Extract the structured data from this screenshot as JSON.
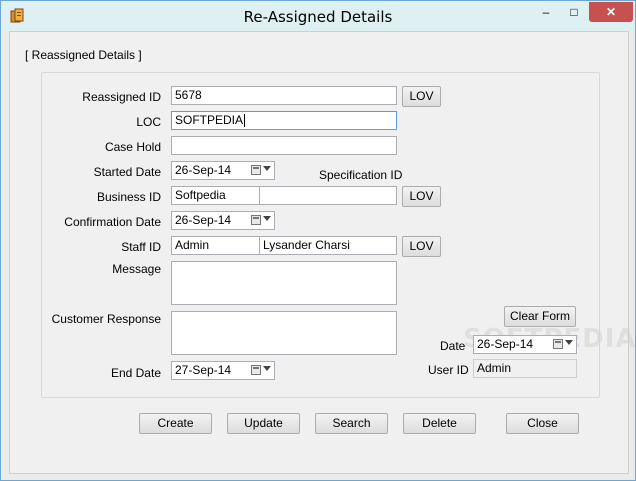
{
  "window": {
    "title": "Re-Assigned Details",
    "minimize": "–",
    "maximize": "□",
    "close": "✕"
  },
  "group": {
    "caption": "[ Reassigned Details ]"
  },
  "labels": {
    "reassigned_id": "Reassigned ID",
    "loc": "LOC",
    "case_hold": "Case Hold",
    "started_date": "Started Date",
    "specification_id": "Specification ID",
    "business_id": "Business ID",
    "confirmation_date": "Confirmation Date",
    "staff_id": "Staff ID",
    "message": "Message",
    "customer_response": "Customer Response",
    "end_date": "End Date",
    "date": "Date",
    "user_id": "User ID"
  },
  "fields": {
    "reassigned_id": "5678",
    "loc": "SOFTPEDIA",
    "case_hold": "",
    "started_date": "26-Sep-14",
    "business_id": "Softpedia",
    "business_name": "",
    "confirmation_date": "26-Sep-14",
    "staff_id": "Admin",
    "staff_name": "Lysander Charsi",
    "message": "",
    "customer_response": "",
    "end_date": "27-Sep-14",
    "date": "26-Sep-14",
    "user_id": "Admin"
  },
  "buttons": {
    "lov": "LOV",
    "clear_form": "Clear Form",
    "create": "Create",
    "update": "Update",
    "search": "Search",
    "delete": "Delete",
    "close": "Close"
  },
  "watermark": "SOFTPEDIA",
  "colors": {
    "close_button": "#c75050",
    "titlebar": "#dff0f3",
    "focus_border": "#569de5"
  }
}
